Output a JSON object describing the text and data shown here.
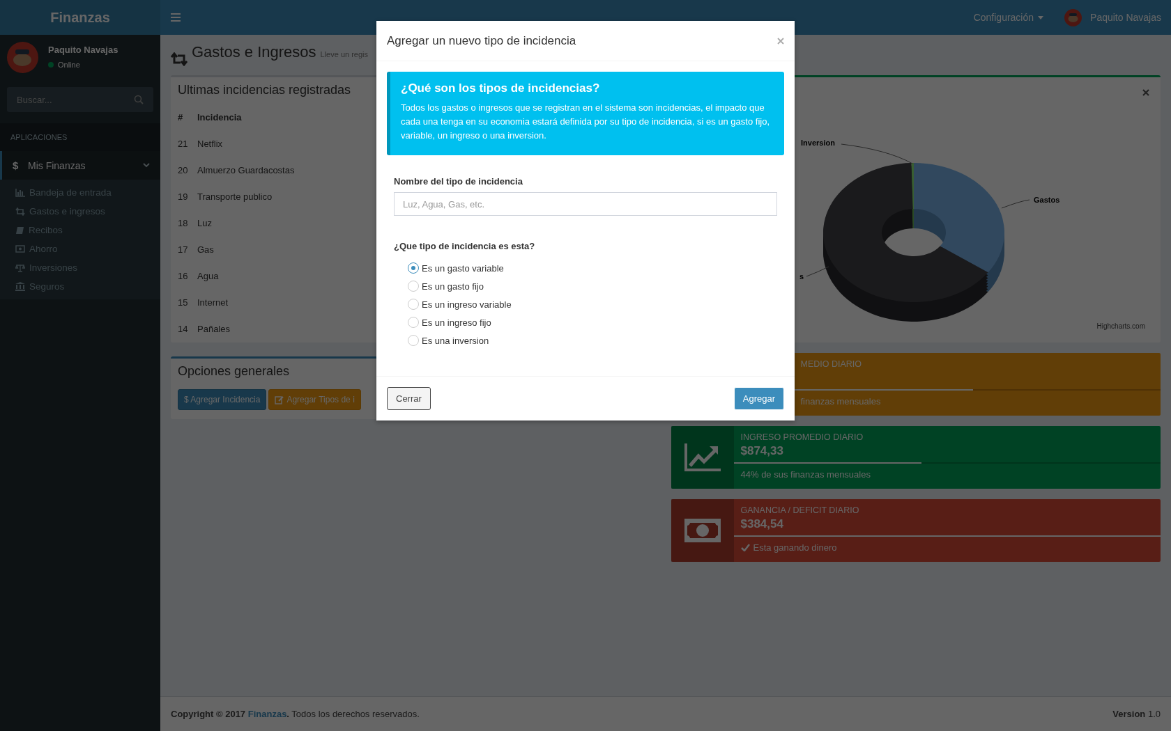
{
  "header": {
    "logo": "Finanzas",
    "config_menu": "Configuración",
    "user_name": "Paquito Navajas"
  },
  "sidebar": {
    "user": {
      "name": "Paquito Navajas",
      "status": "Online"
    },
    "search": {
      "placeholder": "Buscar..."
    },
    "section_label": "APLICACIONES",
    "menu": [
      {
        "glyph": "$",
        "label": "Mis Finanzas",
        "selected": true,
        "expanded": true,
        "children": [
          {
            "label": "Bandeja de entrada"
          },
          {
            "label": "Gastos e ingresos"
          },
          {
            "label": "Recibos"
          },
          {
            "label": "Ahorro"
          },
          {
            "label": "Inversiones"
          },
          {
            "label": "Seguros"
          }
        ]
      }
    ]
  },
  "page": {
    "title": "Gastos e Ingresos",
    "subtitle": "Lleve un regis"
  },
  "incidents_panel": {
    "title": "Ultimas incidencias registradas",
    "columns": [
      "#",
      "Incidencia"
    ],
    "rows": [
      {
        "id": "21",
        "name": "Netflix"
      },
      {
        "id": "20",
        "name": "Almuerzo Guardacostas"
      },
      {
        "id": "19",
        "name": "Transporte publico"
      },
      {
        "id": "18",
        "name": "Luz"
      },
      {
        "id": "17",
        "name": "Gas"
      },
      {
        "id": "16",
        "name": "Agua"
      },
      {
        "id": "15",
        "name": "Internet"
      },
      {
        "id": "14",
        "name": "Pañales"
      }
    ]
  },
  "options_panel": {
    "title": "Opciones generales",
    "buttons": [
      {
        "kind": "primary",
        "label": "$ Agregar Incidencia"
      },
      {
        "kind": "warning",
        "label": "Agregar Tipos de i"
      }
    ]
  },
  "chart_panel": {
    "labels": [
      {
        "kind": "inversion",
        "text": "Inversion"
      },
      {
        "kind": "gastos",
        "text": "Gastos"
      },
      {
        "kind": "ingresos",
        "text": "s"
      }
    ],
    "credit": "Highcharts.com"
  },
  "info_boxes": [
    {
      "kind": "expense",
      "label": "MEDIO DIARIO",
      "level": 0.56,
      "description": "finanzas mensuales"
    },
    {
      "kind": "income",
      "label": "INGRESO PROMEDIO DIARIO",
      "value": "$874,33",
      "level": 0.44,
      "description": "44% de sus finanzas mensuales"
    },
    {
      "kind": "balance",
      "label": "GANANCIA / DEFICIT DIARIO",
      "value": "$384,54",
      "level": 1,
      "description": "Esta ganando dinero"
    }
  ],
  "footer": {
    "prefix": "**Copyright © 2017**",
    "link": "Finanzas",
    "suffix": "**.** Todos los derechos reservados.",
    "version": "**Version** 1.0"
  },
  "modal": {
    "title": "Agregar un nuevo tipo de incidencia",
    "callout": {
      "title": "¿Qué son los tipos de incidencias?",
      "text": "Todos los gastos o ingresos que se registran en el sistema son incidencias, el impacto que cada una tenga en su economia estará definida por su tipo de incidencia, si es un gasto fijo, variable, un ingreso o una inversion."
    },
    "name_field": {
      "label": "Nombre del tipo de incidencia",
      "placeholder": "Luz, Agua, Gas, etc."
    },
    "type_question": "¿Que tipo de incidencia es esta?",
    "options": [
      {
        "label": "Es un gasto variable",
        "selected": true
      },
      {
        "label": "Es un gasto fijo",
        "selected": false
      },
      {
        "label": "Es un ingreso variable",
        "selected": false
      },
      {
        "label": "Es un ingreso fijo",
        "selected": false
      },
      {
        "label": "Es una inversion",
        "selected": false
      }
    ],
    "buttons": [
      {
        "kind": "default",
        "label": "Cerrar"
      },
      {
        "kind": "primary",
        "label": "Agregar"
      }
    ]
  }
}
